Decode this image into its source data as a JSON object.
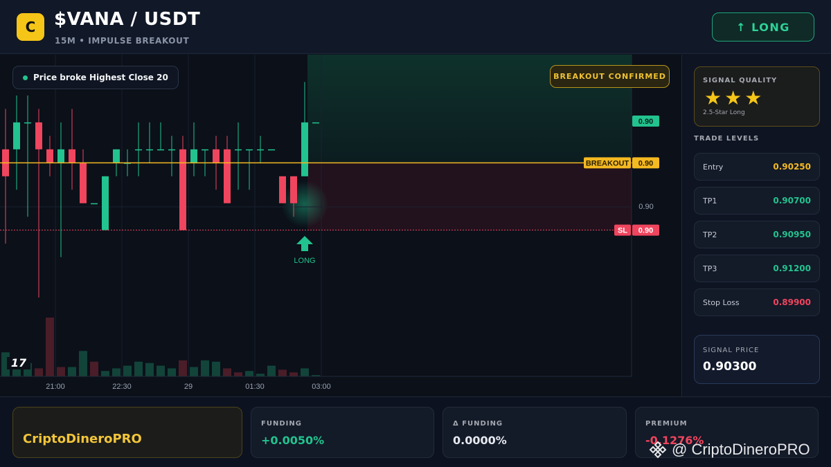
{
  "header": {
    "logo_letter": "C",
    "pair": "$VANA / USDT",
    "subtitle": "15M • IMPULSE BREAKOUT",
    "long_button": "↑ LONG"
  },
  "chart": {
    "signal_tag": "Price broke Highest Close 20",
    "confirmed_badge": "BREAKOUT CONFIRMED",
    "long_marker_label": "LONG",
    "price_labels": {
      "upper": "0.90",
      "breakout_name": "BREAKOUT",
      "breakout_value": "0.90",
      "axis": "0.90",
      "sl_name": "SL",
      "sl_value": "0.90"
    },
    "time_labels": [
      "21:00",
      "22:30",
      "29",
      "01:30",
      "03:00"
    ],
    "tv_logo": "17"
  },
  "chart_data": {
    "type": "candlestick",
    "candles": [
      {
        "open": 0.9026,
        "close": 0.9024,
        "high": 0.9029,
        "low": 0.9019
      },
      {
        "open": 0.9026,
        "close": 0.9028,
        "high": 0.903,
        "low": 0.9023
      },
      {
        "open": 0.9028,
        "close": 0.9028,
        "high": 0.903,
        "low": 0.9021
      },
      {
        "open": 0.9028,
        "close": 0.9026,
        "high": 0.9029,
        "low": 0.9015
      },
      {
        "open": 0.9026,
        "close": 0.9025,
        "high": 0.9027,
        "low": 0.9024
      },
      {
        "open": 0.9025,
        "close": 0.9026,
        "high": 0.9028,
        "low": 0.9018
      },
      {
        "open": 0.9026,
        "close": 0.9025,
        "high": 0.9029,
        "low": 0.9023
      },
      {
        "open": 0.9025,
        "close": 0.9022,
        "high": 0.9026,
        "low": 0.9022
      },
      {
        "open": 0.9022,
        "close": 0.9022,
        "high": 0.9022,
        "low": 0.9022
      },
      {
        "open": 0.902,
        "close": 0.9024,
        "high": 0.9024,
        "low": 0.902
      },
      {
        "open": 0.9025,
        "close": 0.9026,
        "high": 0.9026,
        "low": 0.9024
      },
      {
        "open": 0.9025,
        "close": 0.9025,
        "high": 0.9026,
        "low": 0.9024
      },
      {
        "open": 0.9026,
        "close": 0.9026,
        "high": 0.9028,
        "low": 0.9024
      },
      {
        "open": 0.9026,
        "close": 0.9026,
        "high": 0.9028,
        "low": 0.9025
      },
      {
        "open": 0.9026,
        "close": 0.9026,
        "high": 0.9028,
        "low": 0.9026
      },
      {
        "open": 0.9026,
        "close": 0.9026,
        "high": 0.9027,
        "low": 0.9024
      },
      {
        "open": 0.9026,
        "close": 0.902,
        "high": 0.9027,
        "low": 0.902
      },
      {
        "open": 0.9025,
        "close": 0.9026,
        "high": 0.9028,
        "low": 0.9024
      },
      {
        "open": 0.9026,
        "close": 0.9026,
        "high": 0.9026,
        "low": 0.9024
      },
      {
        "open": 0.9026,
        "close": 0.9025,
        "high": 0.9027,
        "low": 0.9023
      },
      {
        "open": 0.9026,
        "close": 0.9022,
        "high": 0.9027,
        "low": 0.9022
      },
      {
        "open": 0.9026,
        "close": 0.9026,
        "high": 0.9028,
        "low": 0.9023
      },
      {
        "open": 0.9026,
        "close": 0.9026,
        "high": 0.9026,
        "low": 0.9023
      },
      {
        "open": 0.9026,
        "close": 0.9026,
        "high": 0.9027,
        "low": 0.9025
      },
      {
        "open": 0.9026,
        "close": 0.9026,
        "high": 0.9026,
        "low": 0.9026
      },
      {
        "open": 0.9024,
        "close": 0.9022,
        "high": 0.9024,
        "low": 0.9022
      },
      {
        "open": 0.9024,
        "close": 0.9022,
        "high": 0.9024,
        "low": 0.9021
      },
      {
        "open": 0.9024,
        "close": 0.9028,
        "high": 0.9031,
        "low": 0.9024
      },
      {
        "open": 0.9028,
        "close": 0.9028,
        "high": 0.9028,
        "low": 0.9028
      }
    ],
    "volumes": [
      18,
      8,
      10,
      6,
      44,
      7,
      7,
      19,
      11,
      4,
      6,
      8,
      11,
      10,
      8,
      6,
      12,
      7,
      12,
      11,
      6,
      3,
      4,
      2,
      8,
      5,
      3,
      6,
      1
    ],
    "volume_bullish": [
      true,
      true,
      true,
      false,
      false,
      false,
      true,
      true,
      false,
      true,
      true,
      true,
      true,
      true,
      true,
      true,
      false,
      true,
      true,
      true,
      false,
      false,
      true,
      true,
      true,
      false,
      false,
      true,
      true
    ],
    "breakout_level": 0.9025,
    "stop_loss_level": 0.902,
    "ylim": [
      0.9013,
      0.9032
    ]
  },
  "sidebar": {
    "quality_title": "SIGNAL QUALITY",
    "stars": "★★★",
    "quality_sub": "2.5-Star Long",
    "levels_title": "TRADE LEVELS",
    "levels": [
      {
        "label": "Entry",
        "value": "0.90250",
        "color": "#f5b921"
      },
      {
        "label": "TP1",
        "value": "0.90700",
        "color": "#22c38e"
      },
      {
        "label": "TP2",
        "value": "0.90950",
        "color": "#22c38e"
      },
      {
        "label": "TP3",
        "value": "0.91200",
        "color": "#22c38e"
      },
      {
        "label": "Stop Loss",
        "value": "0.89900",
        "color": "#f0455e"
      }
    ],
    "signal_price_title": "SIGNAL PRICE",
    "signal_price": "0.90300"
  },
  "footer": {
    "brand": "CriptoDineroPRO",
    "stats": [
      {
        "label": "FUNDING",
        "value": "+0.0050%",
        "color": "#22c38e"
      },
      {
        "label": "Δ FUNDING",
        "value": "0.0000%",
        "color": "#e6e9ef"
      },
      {
        "label": "PREMIUM",
        "value": "-0.1276%",
        "color": "#f0455e"
      }
    ],
    "watermark": "@ CriptoDineroPRO"
  },
  "colors": {
    "bull": "#22c38e",
    "bear": "#f0455e",
    "breakout": "#f5b921",
    "accent": "#f5c518"
  }
}
